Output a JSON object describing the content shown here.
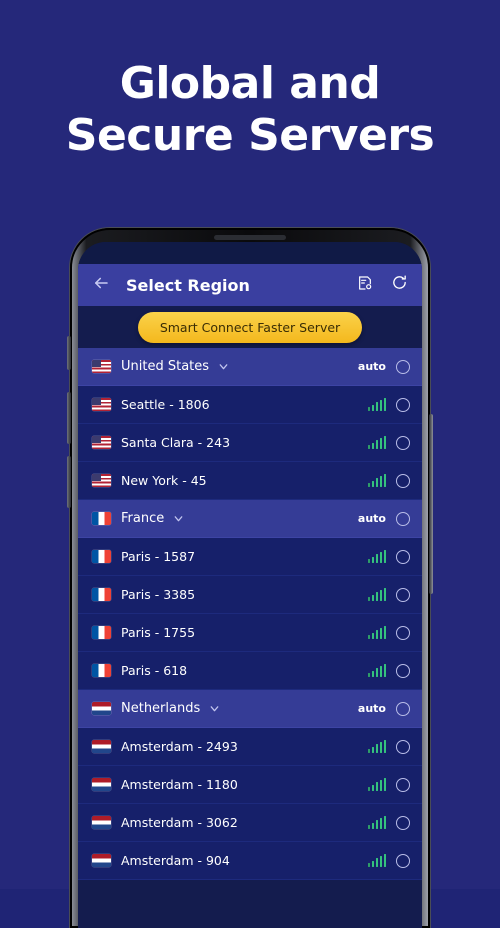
{
  "promo": {
    "headline_line1": "Global and",
    "headline_line2": "Secure Servers",
    "background_color": "#25287a",
    "text_color": "#ffffff"
  },
  "app": {
    "appbar": {
      "back_icon": "arrow-left-icon",
      "title": "Select Region",
      "actions": [
        {
          "icon": "server-settings-icon"
        },
        {
          "icon": "refresh-icon"
        }
      ],
      "background_color": "#3a3fa0"
    },
    "smart_connect": {
      "label": "Smart Connect Faster Server",
      "background_color": "#f4b81d",
      "text_color": "#3a2d05"
    },
    "list": {
      "auto_label": "auto",
      "chevron_icon": "chevron-down-icon",
      "signal_icon": "signal-bars-icon",
      "radio_icon": "radio-unselected-icon",
      "groups": [
        {
          "country": "United States",
          "flag": "us",
          "auto_label": "auto",
          "servers": [
            {
              "name": "Seattle - 1806",
              "flag": "us",
              "signal": 5
            },
            {
              "name": "Santa Clara - 243",
              "flag": "us",
              "signal": 5
            },
            {
              "name": "New York - 45",
              "flag": "us",
              "signal": 5
            }
          ]
        },
        {
          "country": "France",
          "flag": "fr",
          "auto_label": "auto",
          "servers": [
            {
              "name": "Paris - 1587",
              "flag": "fr",
              "signal": 5
            },
            {
              "name": "Paris - 3385",
              "flag": "fr",
              "signal": 5
            },
            {
              "name": "Paris - 1755",
              "flag": "fr",
              "signal": 5
            },
            {
              "name": "Paris - 618",
              "flag": "fr",
              "signal": 5
            }
          ]
        },
        {
          "country": "Netherlands",
          "flag": "nl",
          "auto_label": "auto",
          "servers": [
            {
              "name": "Amsterdam - 2493",
              "flag": "nl",
              "signal": 5
            },
            {
              "name": "Amsterdam - 1180",
              "flag": "nl",
              "signal": 5
            },
            {
              "name": "Amsterdam - 3062",
              "flag": "nl",
              "signal": 5
            },
            {
              "name": "Amsterdam - 904",
              "flag": "nl",
              "signal": 5
            }
          ]
        }
      ]
    }
  }
}
